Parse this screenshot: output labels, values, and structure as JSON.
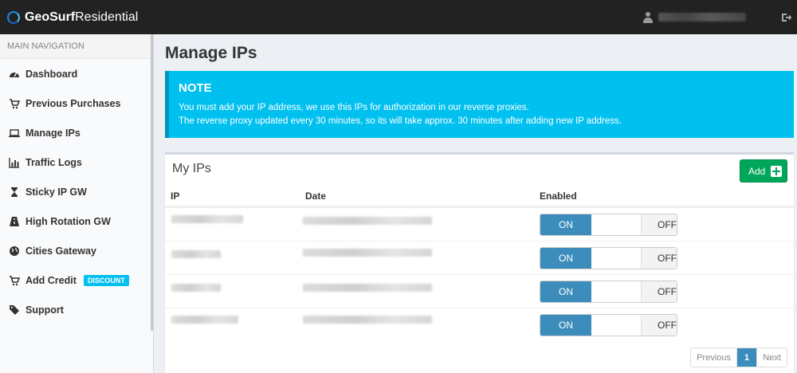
{
  "brand": {
    "bold": "GeoSurf",
    "light": "Residential"
  },
  "header": {
    "user_icon": "user-icon",
    "logout_icon": "sign-out-icon"
  },
  "sidebar": {
    "header": "MAIN NAVIGATION",
    "items": [
      {
        "label": "Dashboard",
        "icon": "dashboard-icon"
      },
      {
        "label": "Previous Purchases",
        "icon": "shopping-cart-icon"
      },
      {
        "label": "Manage IPs",
        "icon": "laptop-icon"
      },
      {
        "label": "Traffic Logs",
        "icon": "bar-chart-icon"
      },
      {
        "label": "Sticky IP GW",
        "icon": "hourglass-icon"
      },
      {
        "label": "High Rotation GW",
        "icon": "road-icon"
      },
      {
        "label": "Cities Gateway",
        "icon": "globe-icon"
      },
      {
        "label": "Add Credit",
        "icon": "cart-plus-icon",
        "badge": "DISCOUNT"
      },
      {
        "label": "Support",
        "icon": "tag-icon"
      }
    ]
  },
  "page": {
    "title": "Manage IPs"
  },
  "note": {
    "title": "NOTE",
    "line1": "You must add your IP address, we use this IPs for authorization in our reverse proxies.",
    "line2": "The reverse proxy updated every 30 minutes, so its will take approx. 30 minutes after adding new IP address."
  },
  "ips_box": {
    "title": "My IPs",
    "add_label": "Add",
    "columns": {
      "ip": "IP",
      "date": "Date",
      "enabled": "Enabled"
    },
    "rows": [
      {
        "enabled": true
      },
      {
        "enabled": true
      },
      {
        "enabled": true
      },
      {
        "enabled": true
      }
    ],
    "toggle": {
      "on": "ON",
      "off": "OFF"
    }
  },
  "pagination": {
    "previous": "Previous",
    "current": "1",
    "next": "Next"
  },
  "colors": {
    "accent": "#3c8dbc",
    "note_bg": "#00c0ef",
    "add_button": "#00a65a",
    "topbar": "#222222"
  }
}
